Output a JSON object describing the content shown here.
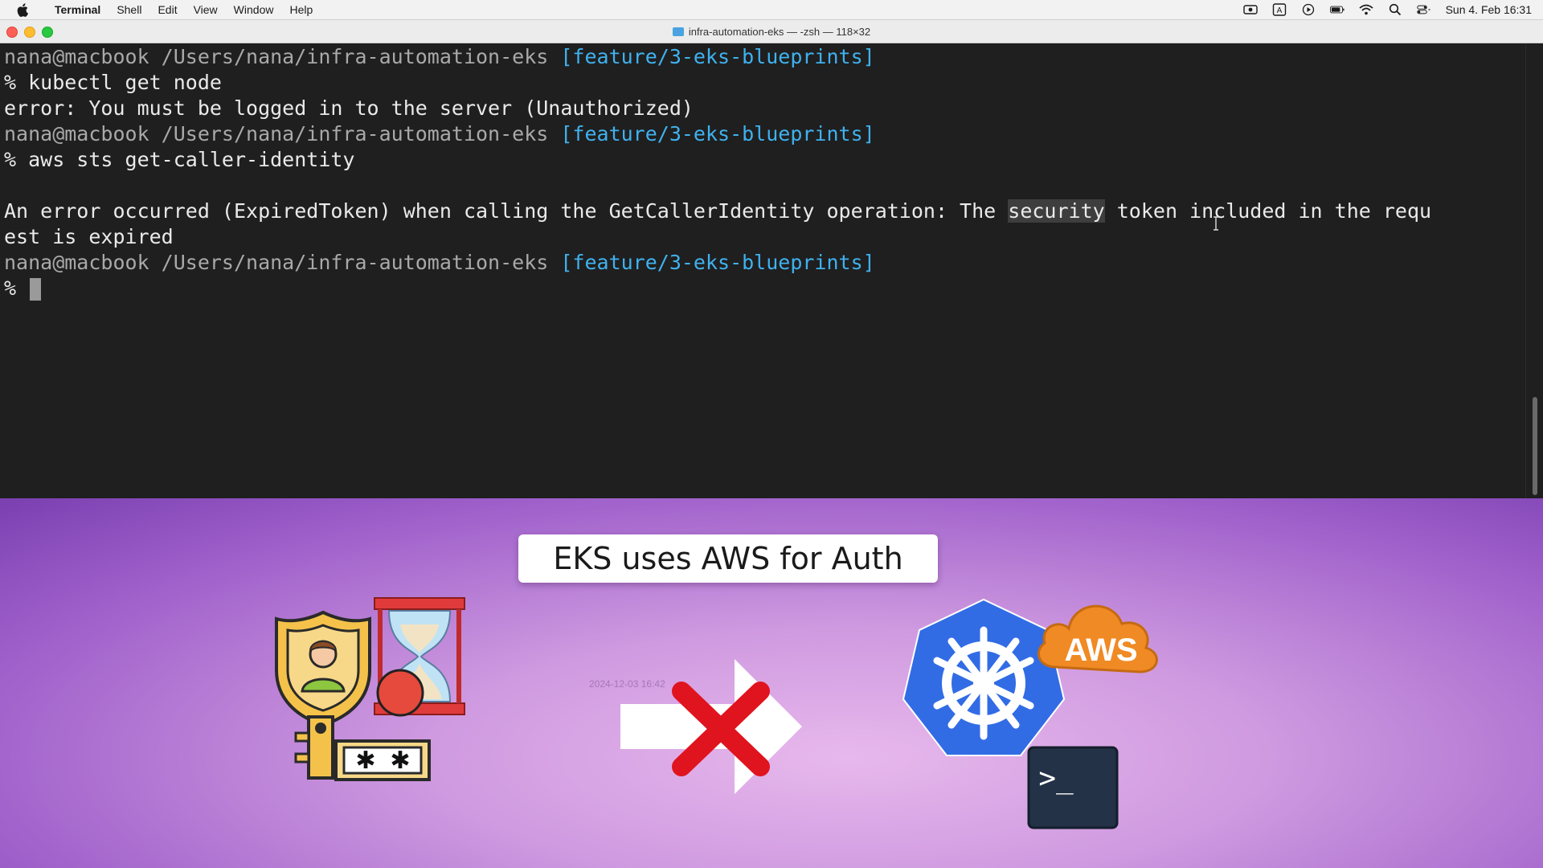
{
  "menubar": {
    "app": "Terminal",
    "items": [
      "Shell",
      "Edit",
      "View",
      "Window",
      "Help"
    ],
    "clock": "Sun 4. Feb  16:31"
  },
  "window": {
    "title": "infra-automation-eks — -zsh — 118×32"
  },
  "terminal": {
    "lines": [
      {
        "path": "nana@macbook /Users/nana/infra-automation-eks ",
        "branch": "[feature/3-eks-blueprints]"
      },
      {
        "text": "% kubectl get node"
      },
      {
        "text": "error: You must be logged in to the server (Unauthorized)"
      },
      {
        "path": "nana@macbook /Users/nana/infra-automation-eks ",
        "branch": "[feature/3-eks-blueprints]"
      },
      {
        "text": "% aws sts get-caller-identity"
      },
      {
        "text": ""
      },
      {
        "pre": "An error occurred (ExpiredToken) when calling the GetCallerIdentity operation: The ",
        "highlight": "security",
        "post": " token included in the requ"
      },
      {
        "text": "est is expired"
      },
      {
        "path": "nana@macbook /Users/nana/infra-automation-eks ",
        "branch": "[feature/3-eks-blueprints]"
      },
      {
        "text": "% "
      }
    ]
  },
  "overlay": {
    "banner": "EKS uses AWS for Auth",
    "aws_badge": "AWS",
    "terminal_icon_glyph": ">_",
    "timestamp": "2024-12-03 16:42",
    "colors": {
      "aws_orange": "#f08a24",
      "k8s_blue": "#326ce5",
      "cross_red": "#e0141e"
    }
  }
}
